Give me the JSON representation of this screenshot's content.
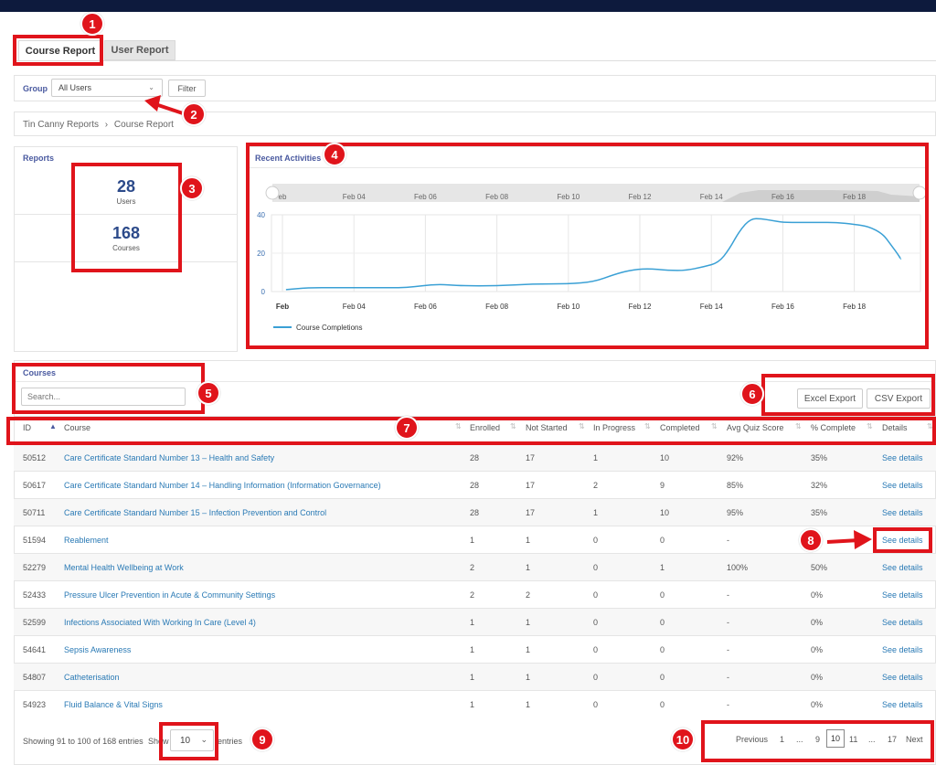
{
  "tabs": [
    {
      "label": "Course Report"
    },
    {
      "label": "User Report"
    }
  ],
  "filter": {
    "group_label": "Group",
    "group_value": "All Users",
    "filter_button": "Filter"
  },
  "breadcrumb": {
    "root": "Tin Canny Reports",
    "separator": "›",
    "current": "Course Report"
  },
  "reports": {
    "title": "Reports",
    "users_count": "28",
    "users_label": "Users",
    "courses_count": "168",
    "courses_label": "Courses"
  },
  "activities": {
    "title": "Recent Activities",
    "navigator_labels": [
      "eb",
      "Feb 04",
      "Feb 06",
      "Feb 08",
      "Feb 10",
      "Feb 12",
      "Feb 14",
      "Feb 16",
      "Feb 18"
    ],
    "legend": "Course Completions"
  },
  "chart_data": {
    "type": "line",
    "title": "Recent Activities",
    "xlabel": "",
    "ylabel": "",
    "x_ticks": [
      "Feb",
      "Feb 04",
      "Feb 06",
      "Feb 08",
      "Feb 10",
      "Feb 12",
      "Feb 14",
      "Feb 16",
      "Feb 18"
    ],
    "y_ticks": [
      "0",
      "20",
      "40"
    ],
    "ylim": [
      0,
      40
    ],
    "legend_position": "bottom-left",
    "grid": true,
    "series_color": "#3aa0d5",
    "series": [
      {
        "name": "Course Completions",
        "x": [
          2.1,
          2.7,
          3.5,
          4.5,
          5.5,
          6.3,
          7.0,
          8.0,
          9.0,
          10.0,
          10.7,
          11.3,
          11.7,
          12.2,
          12.8,
          13.3,
          13.8,
          14.2,
          14.5,
          14.8,
          15.1,
          15.4,
          15.7,
          16.0,
          16.5,
          17.0,
          17.5,
          18.0,
          18.4,
          18.8,
          19.0,
          19.2,
          19.3
        ],
        "y": [
          1,
          2,
          2,
          2,
          2,
          4,
          3,
          3,
          4,
          4,
          5,
          9,
          11,
          12,
          11,
          11,
          13,
          15,
          22,
          32,
          38,
          38,
          37,
          36,
          36,
          36,
          36,
          35,
          34,
          30,
          25,
          20,
          17
        ]
      }
    ]
  },
  "courses": {
    "title": "Courses",
    "search_placeholder": "Search...",
    "excel_export": "Excel Export",
    "csv_export": "CSV Export",
    "columns": [
      "ID",
      "Course",
      "Enrolled",
      "Not Started",
      "In Progress",
      "Completed",
      "Avg Quiz Score",
      "% Complete",
      "Details"
    ],
    "rows": [
      [
        "50512",
        "Care Certificate Standard Number 13 – Health and Safety",
        "28",
        "17",
        "1",
        "10",
        "92%",
        "35%",
        "See details"
      ],
      [
        "50617",
        "Care Certificate Standard Number 14 – Handling Information (Information Governance)",
        "28",
        "17",
        "2",
        "9",
        "85%",
        "32%",
        "See details"
      ],
      [
        "50711",
        "Care Certificate Standard Number 15 – Infection Prevention and Control",
        "28",
        "17",
        "1",
        "10",
        "95%",
        "35%",
        "See details"
      ],
      [
        "51594",
        "Reablement",
        "1",
        "1",
        "0",
        "0",
        "-",
        "0%",
        "See details"
      ],
      [
        "52279",
        "Mental Health Wellbeing at Work",
        "2",
        "1",
        "0",
        "1",
        "100%",
        "50%",
        "See details"
      ],
      [
        "52433",
        "Pressure Ulcer Prevention in Acute & Community Settings",
        "2",
        "2",
        "0",
        "0",
        "-",
        "0%",
        "See details"
      ],
      [
        "52599",
        "Infections Associated With Working In Care (Level 4)",
        "1",
        "1",
        "0",
        "0",
        "-",
        "0%",
        "See details"
      ],
      [
        "54641",
        "Sepsis Awareness",
        "1",
        "1",
        "0",
        "0",
        "-",
        "0%",
        "See details"
      ],
      [
        "54807",
        "Catheterisation",
        "1",
        "1",
        "0",
        "0",
        "-",
        "0%",
        "See details"
      ],
      [
        "54923",
        "Fluid Balance & Vital Signs",
        "1",
        "1",
        "0",
        "0",
        "-",
        "0%",
        "See details"
      ]
    ],
    "showing_text": "Showing 91 to 100 of 168 entries",
    "show_label": "Show",
    "page_size": "10",
    "entries_label": "entries",
    "pagination": {
      "previous": "Previous",
      "pages": [
        "1",
        "...",
        "9",
        "10",
        "11",
        "...",
        "17"
      ],
      "next": "Next"
    }
  },
  "annotations": [
    "1",
    "2",
    "3",
    "4",
    "5",
    "6",
    "7",
    "8",
    "9",
    "10"
  ],
  "colors": {
    "annotation": "#e0141b",
    "link": "#2a7ab5",
    "stat": "#2c4a8a",
    "topbar": "#0d1a3d"
  }
}
